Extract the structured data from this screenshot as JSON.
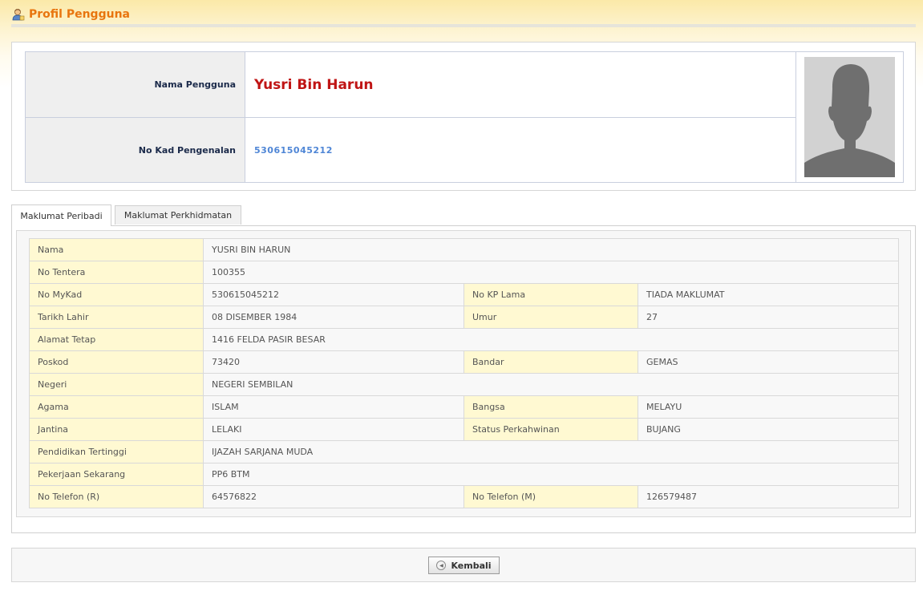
{
  "page": {
    "title": "Profil Pengguna",
    "title_icon": "user-profile-icon"
  },
  "header": {
    "name_label": "Nama Pengguna",
    "name_value": "Yusri Bin Harun",
    "ic_label": "No Kad Pengenalan",
    "ic_value": "530615045212",
    "photo_icon": "person-silhouette-icon"
  },
  "tabs": [
    {
      "label": "Maklumat Peribadi",
      "active": true
    },
    {
      "label": "Maklumat Perkhidmatan",
      "active": false
    }
  ],
  "details": {
    "rows": [
      {
        "l1": "Nama",
        "v1": "YUSRI BIN HARUN"
      },
      {
        "l1": "No Tentera",
        "v1": "100355"
      },
      {
        "l1": "No MyKad",
        "v1": "530615045212",
        "l2": "No KP Lama",
        "v2": "TIADA MAKLUMAT"
      },
      {
        "l1": "Tarikh Lahir",
        "v1": "08 DISEMBER 1984",
        "l2": "Umur",
        "v2": "27"
      },
      {
        "l1": "Alamat Tetap",
        "v1": "1416 FELDA PASIR BESAR"
      },
      {
        "l1": "Poskod",
        "v1": "73420",
        "l2": "Bandar",
        "v2": "GEMAS"
      },
      {
        "l1": "Negeri",
        "v1": "NEGERI SEMBILAN"
      },
      {
        "l1": "Agama",
        "v1": "ISLAM",
        "l2": "Bangsa",
        "v2": "MELAYU"
      },
      {
        "l1": "Jantina",
        "v1": "LELAKI",
        "l2": "Status Perkahwinan",
        "v2": "BUJANG"
      },
      {
        "l1": "Pendidikan Tertinggi",
        "v1": "IJAZAH SARJANA MUDA"
      },
      {
        "l1": "Pekerjaan Sekarang",
        "v1": "PP6 BTM"
      },
      {
        "l1": "No Telefon (R)",
        "v1": "64576822",
        "l2": "No Telefon (M)",
        "v2": "126579487"
      }
    ]
  },
  "footer": {
    "back_label": "Kembali",
    "back_icon": "arrow-left-circle-icon"
  },
  "colors": {
    "title": "#e8750e",
    "name": "#c01515",
    "ic": "#4f86d6",
    "label_bg": "#fff9d2"
  }
}
